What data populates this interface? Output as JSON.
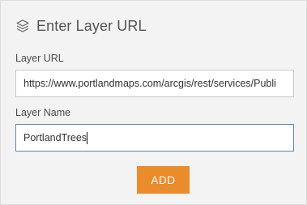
{
  "header": {
    "icon": "layers-icon",
    "title": "Enter Layer URL"
  },
  "form": {
    "layer_url": {
      "label": "Layer URL",
      "value": "https://www.portlandmaps.com/arcgis/rest/services/Publi"
    },
    "layer_name": {
      "label": "Layer Name",
      "value": "PortlandTrees"
    }
  },
  "actions": {
    "add_label": "ADD"
  },
  "colors": {
    "panel_background": "#f3f3f3",
    "accent": "#ea8b2c",
    "focused_border": "#6a86a8"
  }
}
